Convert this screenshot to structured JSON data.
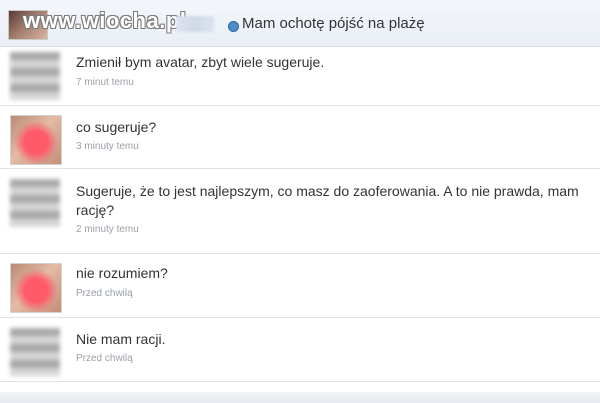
{
  "watermark": "www.wiocha.pl",
  "header": {
    "status_icon": "status-dot-icon",
    "status_text": "Mam ochotę pójść na plażę"
  },
  "comments": [
    {
      "text": "Zmienił bym avatar, zbyt wiele sugeruje.",
      "time": "7 minut temu"
    },
    {
      "text": "co sugeruje?",
      "time": "3 minuty temu"
    },
    {
      "text": "Sugeruje, że to jest najlepszym, co masz do zaoferowania. A to nie prawda, mam rację?",
      "time": "2 minuty temu"
    },
    {
      "text": "nie rozumiem?",
      "time": "Przed chwilą"
    },
    {
      "text": "Nie mam racji.",
      "time": "Przed chwilą"
    }
  ]
}
